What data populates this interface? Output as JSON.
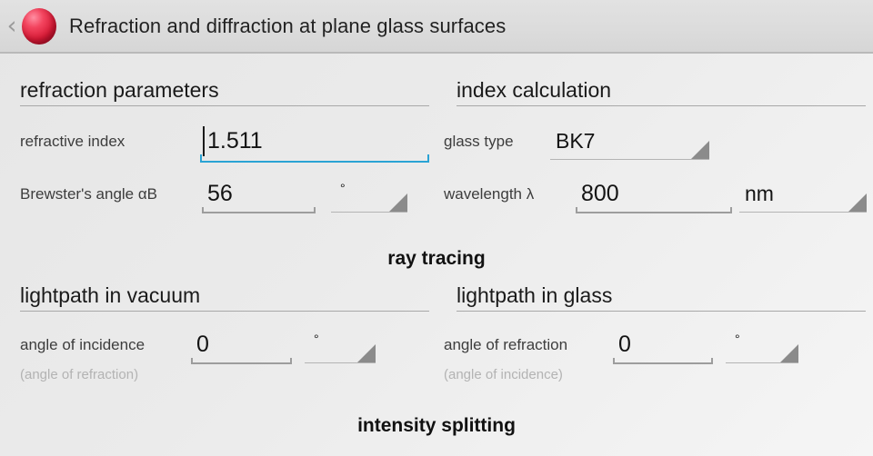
{
  "titlebar": {
    "back_icon": "chevron-left-icon",
    "app_icon": "red-sphere-icon",
    "title": "Refraction and diffraction at plane glass surfaces"
  },
  "sections": {
    "refraction_parameters": {
      "heading": "refraction parameters",
      "fields": {
        "refractive_index": {
          "label": "refractive index",
          "value": "1.511",
          "focused": true
        },
        "brewsters_angle": {
          "label": "Brewster's angle αB",
          "value": "56",
          "unit": "°"
        }
      }
    },
    "index_calculation": {
      "heading": "index calculation",
      "fields": {
        "glass_type": {
          "label": "glass type",
          "value": "BK7"
        },
        "wavelength": {
          "label": "wavelength λ",
          "value": "800",
          "unit": "nm"
        }
      }
    },
    "ray_tracing": {
      "heading": "ray tracing",
      "vacuum": {
        "heading": "lightpath in vacuum",
        "field": {
          "label": "angle of incidence",
          "hint": "(angle of refraction)",
          "value": "0",
          "unit": "°"
        }
      },
      "glass": {
        "heading": "lightpath in glass",
        "field": {
          "label": "angle of refraction",
          "hint": "(angle of incidence)",
          "value": "0",
          "unit": "°"
        }
      }
    },
    "intensity_splitting": {
      "heading": "intensity splitting"
    }
  },
  "colors": {
    "accent_focus": "#2aa3d4",
    "app_icon": "#d81b37",
    "titlebar_bg": "#dcdcdc",
    "hint_text": "#b3b3b3"
  }
}
